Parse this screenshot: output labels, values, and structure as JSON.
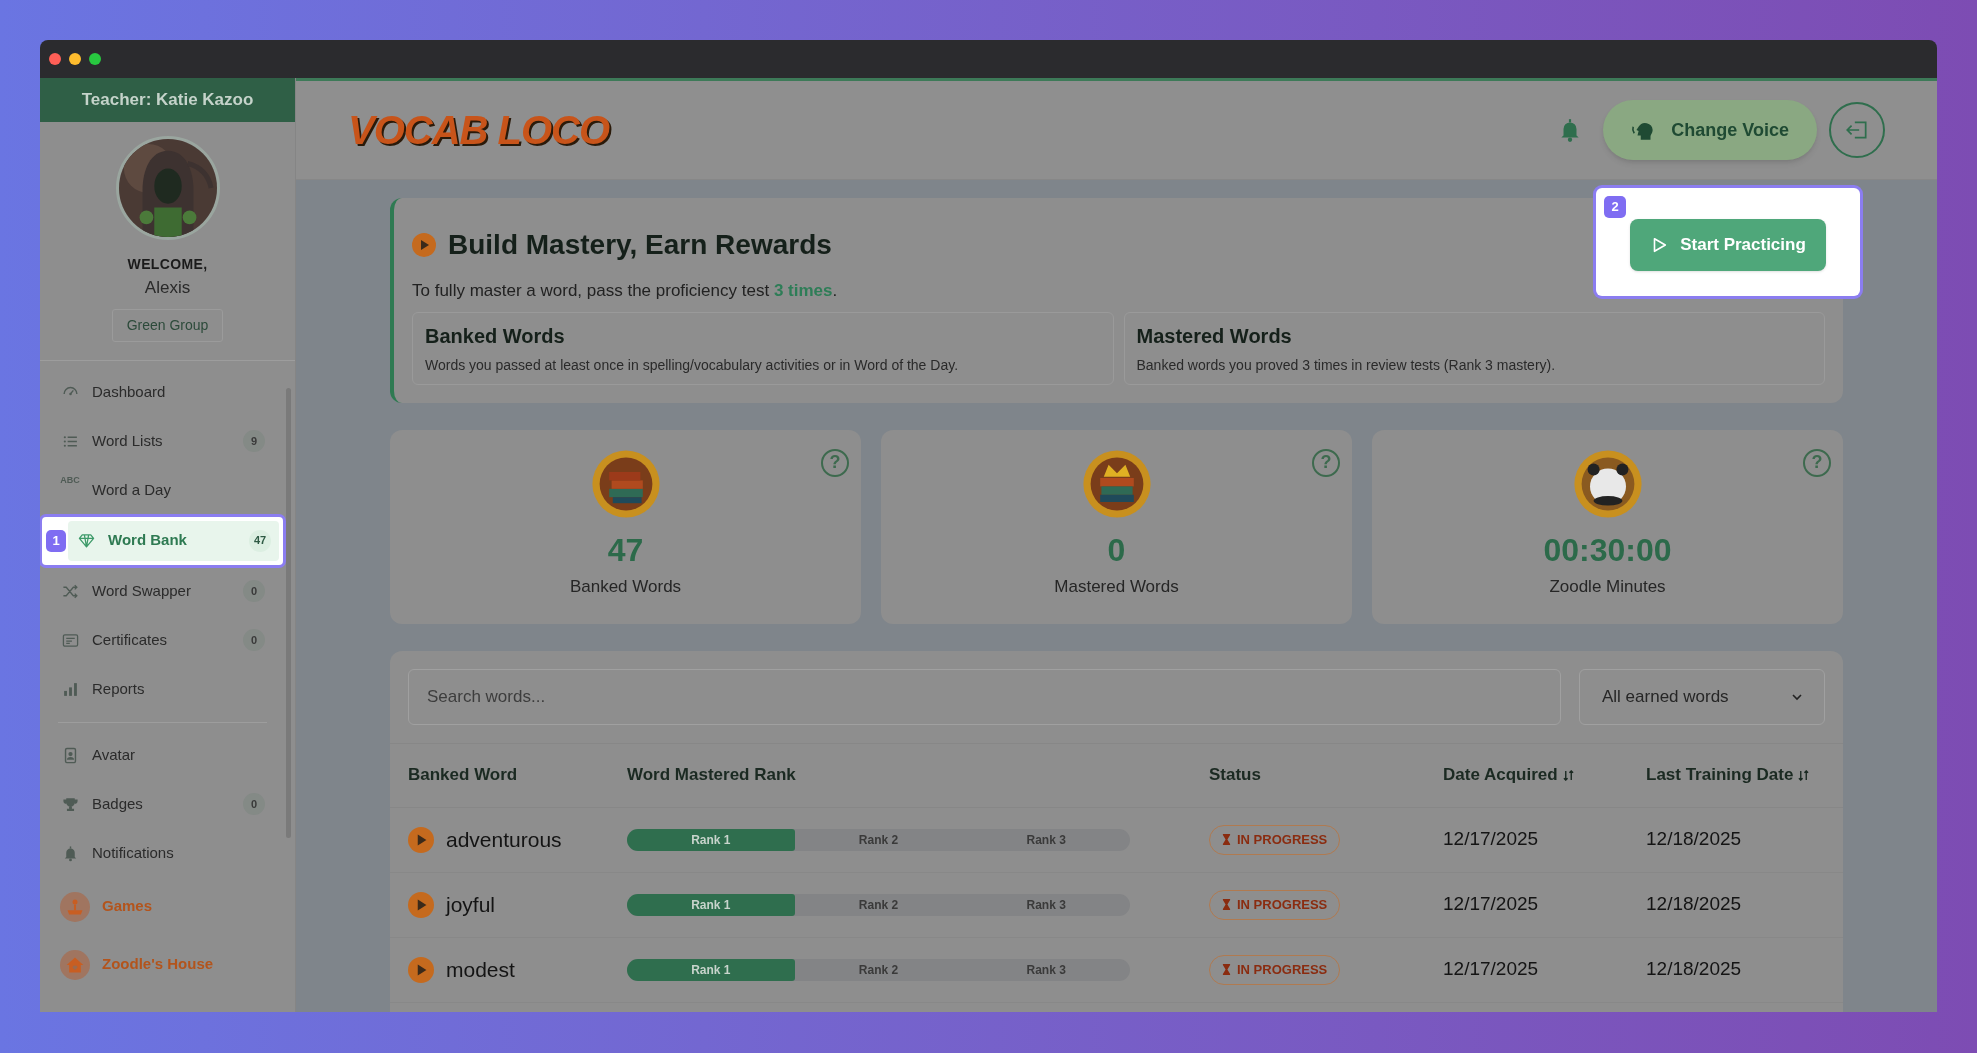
{
  "sidebar": {
    "teacher": "Teacher: Katie Kazoo",
    "welcome": "WELCOME,",
    "student": "Alexis",
    "group": "Green Group",
    "nav_groups": [
      [
        {
          "label": "Dashboard",
          "kind": "plain",
          "selected": false
        },
        {
          "label": "Word Lists",
          "kind": "plain",
          "count": "9",
          "selected": false
        },
        {
          "label": "Word a Day",
          "kind": "plain",
          "icon_text": "ABC",
          "selected": false
        },
        {
          "label": "Word Bank",
          "kind": "plain",
          "count": "47",
          "selected": true,
          "tour_marker": "1"
        },
        {
          "label": "Word Swapper",
          "kind": "plain",
          "count": "0",
          "selected": false
        },
        {
          "label": "Certificates",
          "kind": "plain",
          "count": "0",
          "selected": false
        },
        {
          "label": "Reports",
          "kind": "plain",
          "selected": false
        }
      ],
      [
        {
          "label": "Avatar",
          "kind": "plain",
          "selected": false
        },
        {
          "label": "Badges",
          "kind": "plain",
          "count": "0",
          "selected": false
        },
        {
          "label": "Notifications",
          "kind": "plain",
          "selected": false
        },
        {
          "label": "Games",
          "kind": "feature",
          "selected": false
        },
        {
          "label": "Zoodle's House",
          "kind": "feature",
          "selected": false
        }
      ]
    ]
  },
  "header": {
    "logo": "VOCAB LOCO",
    "voice_button": "Change Voice"
  },
  "mastery": {
    "title": "Build Mastery, Earn Rewards",
    "text": "To fully master a word, pass the proficiency test **3 times**.",
    "tour_marker": "2",
    "button": "Start Practicing",
    "definitions": [
      {
        "title": "Banked Words",
        "text": "Words you passed at least once in spelling/vocabulary activities or in Word of the Day."
      },
      {
        "title": "Mastered Words",
        "text": "Banked words you proved 3 times in review tests (Rank 3 mastery)."
      }
    ]
  },
  "stats": [
    {
      "value": "47",
      "label": "Banked Words",
      "help": "?"
    },
    {
      "value": "0",
      "label": "Mastered Words",
      "help": "?"
    },
    {
      "value": "00:30:00",
      "label": "Zoodle Minutes",
      "help": "?"
    }
  ],
  "table": {
    "search_placeholder": "Search words...",
    "filter": "All earned words",
    "columns": [
      {
        "label": "Banked Word",
        "sortable": false
      },
      {
        "label": "Word Mastered Rank",
        "sortable": false
      },
      {
        "label": "Status",
        "sortable": false
      },
      {
        "label": "Date Acquired",
        "sortable": true
      },
      {
        "label": "Last Training Date",
        "sortable": true
      }
    ],
    "rows": [
      {
        "word": "adventurous",
        "ranks": [
          {
            "label": "Rank 1",
            "reached": true
          },
          {
            "label": "Rank 2",
            "reached": false
          },
          {
            "label": "Rank 3",
            "reached": false
          }
        ],
        "status": "IN PROGRESS",
        "date_acquired": "12/17/2025",
        "last_training": "12/18/2025"
      },
      {
        "word": "joyful",
        "ranks": [
          {
            "label": "Rank 1",
            "reached": true
          },
          {
            "label": "Rank 2",
            "reached": false
          },
          {
            "label": "Rank 3",
            "reached": false
          }
        ],
        "status": "IN PROGRESS",
        "date_acquired": "12/17/2025",
        "last_training": "12/18/2025"
      },
      {
        "word": "modest",
        "ranks": [
          {
            "label": "Rank 1",
            "reached": true
          },
          {
            "label": "Rank 2",
            "reached": false
          },
          {
            "label": "Rank 3",
            "reached": false
          }
        ],
        "status": "IN PROGRESS",
        "date_acquired": "12/17/2025",
        "last_training": "12/18/2025"
      }
    ]
  }
}
